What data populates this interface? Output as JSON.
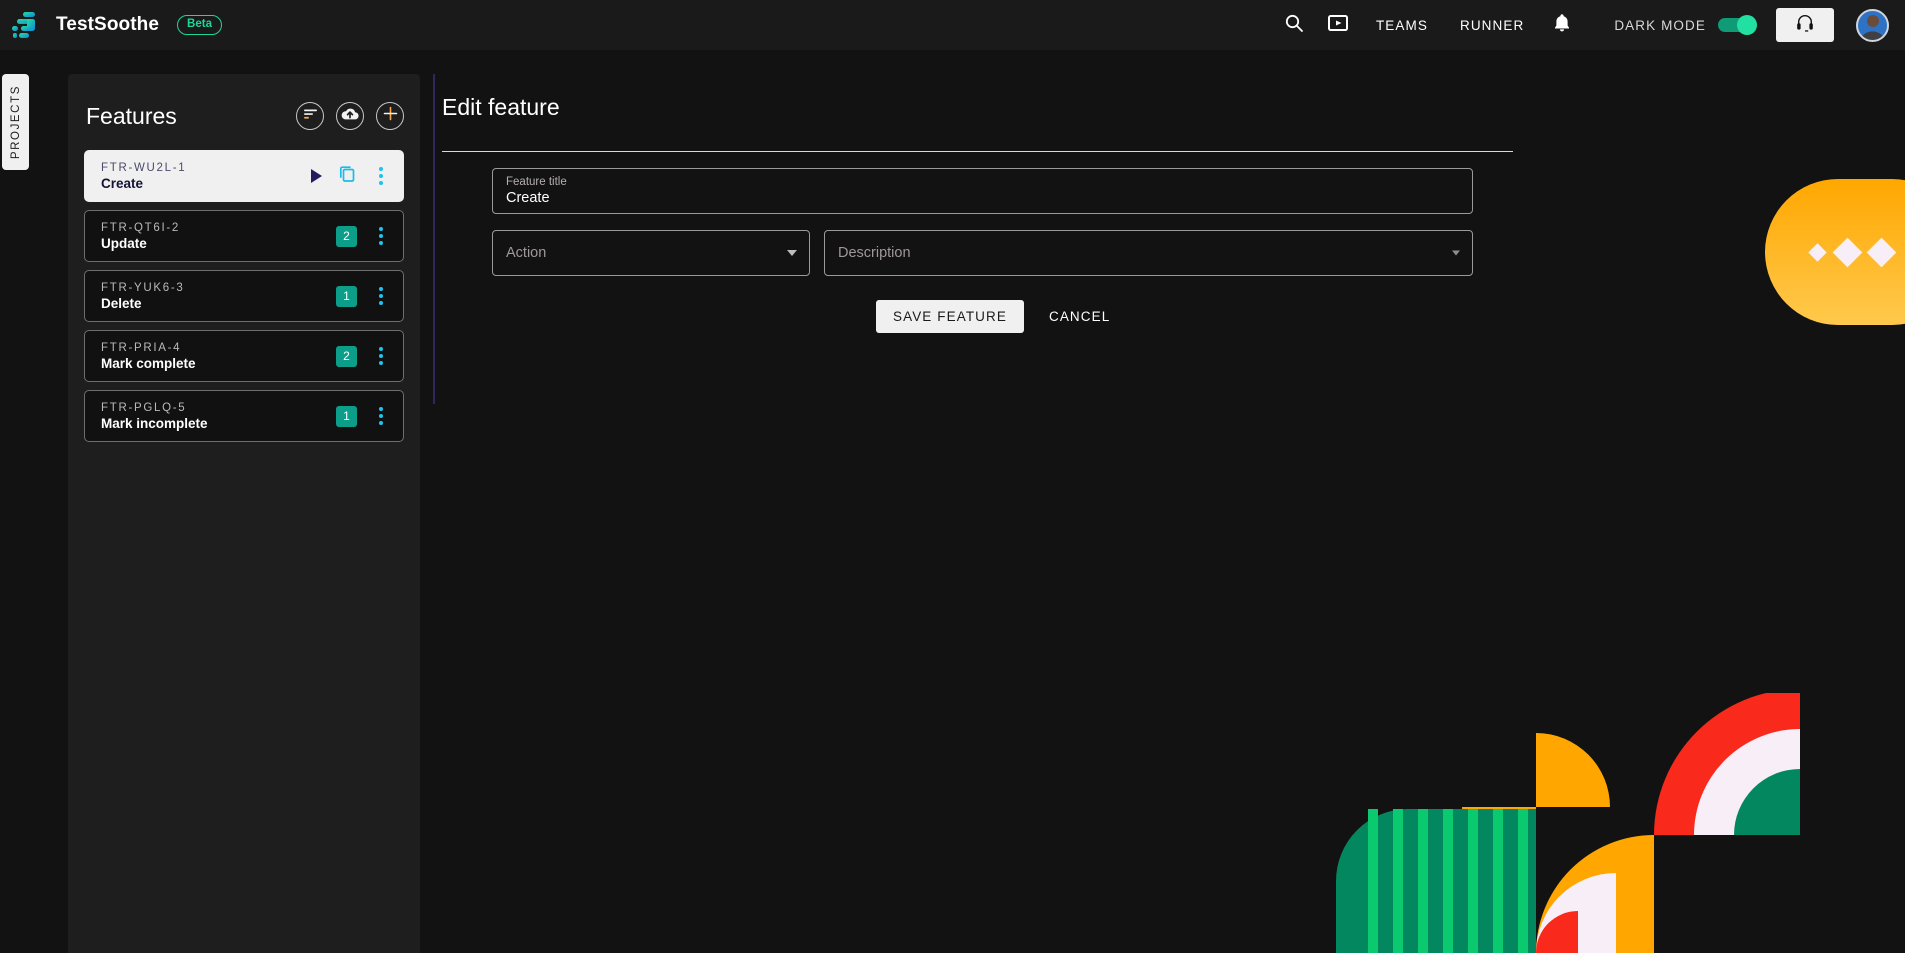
{
  "topbar": {
    "brand_name": "TestSoothe",
    "beta_label": "Beta",
    "search_icon": "search-icon",
    "video_icon": "video-player-icon",
    "teams_label": "TEAMS",
    "runner_label": "RUNNER",
    "bell_icon": "bell-icon",
    "dark_mode_label": "DARK MODE",
    "dark_mode_on": true,
    "support_icon": "headset-icon",
    "avatar": "user-avatar"
  },
  "sidebar": {
    "projects_tab_label": "PROJECTS"
  },
  "features_panel": {
    "title": "Features",
    "actions": [
      {
        "name": "sort-icon",
        "label": "Sort"
      },
      {
        "name": "cloud-upload-icon",
        "label": "Upload"
      },
      {
        "name": "plus-icon",
        "label": "Add feature"
      }
    ],
    "items": [
      {
        "code": "FTR-WU2L-1",
        "name": "Create",
        "badge": null,
        "active": true,
        "has_play": true,
        "has_copy": true
      },
      {
        "code": "FTR-QT6I-2",
        "name": "Update",
        "badge": "2",
        "active": false,
        "has_play": false,
        "has_copy": false
      },
      {
        "code": "FTR-YUK6-3",
        "name": "Delete",
        "badge": "1",
        "active": false,
        "has_play": false,
        "has_copy": false
      },
      {
        "code": "FTR-PRIA-4",
        "name": "Mark complete",
        "badge": "2",
        "active": false,
        "has_play": false,
        "has_copy": false
      },
      {
        "code": "FTR-PGLQ-5",
        "name": "Mark incomplete",
        "badge": "1",
        "active": false,
        "has_play": false,
        "has_copy": false
      }
    ]
  },
  "main": {
    "page_title": "Edit feature",
    "feature_title_field": {
      "label": "Feature title",
      "value": "Create"
    },
    "action_field": {
      "placeholder": "Action",
      "value": ""
    },
    "description_field": {
      "placeholder": "Description",
      "value": ""
    },
    "save_label": "SAVE FEATURE",
    "cancel_label": "CANCEL"
  },
  "colors": {
    "accent_green": "#19d99a",
    "badge_teal": "#0d9e8a",
    "kebab_blue": "#1fc3f0",
    "copy_cyan": "#18bde8",
    "play_navy": "#231b5e",
    "decor_orange": "#ffa700",
    "decor_red": "#f92a1c",
    "decor_green": "#03875f",
    "page_bg": "#121212",
    "panel_bg": "#1e1e1e"
  }
}
